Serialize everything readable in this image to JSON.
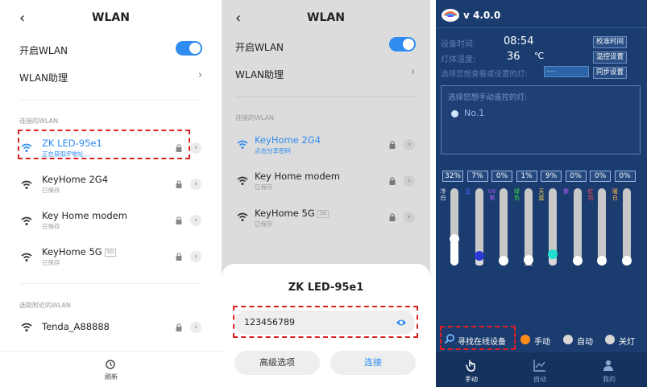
{
  "panel1": {
    "title": "WLAN",
    "wlan_toggle_label": "开启WLAN",
    "assistant_label": "WLAN助理",
    "connected_section": "连接的WLAN",
    "networks": [
      {
        "name": "ZK LED-95e1",
        "sub": "正在获取IP地址..."
      },
      {
        "name": "KeyHome 2G4",
        "sub": "已保存"
      },
      {
        "name": "Key Home modem",
        "sub": "已保存"
      },
      {
        "name": "KeyHome 5G",
        "badge": "5G",
        "sub": "已保存"
      }
    ],
    "nearby_section": "选取附近的WLAN",
    "nearby_networks": [
      {
        "name": "Tenda_A88888"
      }
    ],
    "refresh_label": "刷新"
  },
  "panel2": {
    "title": "WLAN",
    "wlan_toggle_label": "开启WLAN",
    "assistant_label": "WLAN助理",
    "connected_section": "连接的WLAN",
    "networks": [
      {
        "name": "KeyHome 2G4",
        "sub": "点击分享密码"
      },
      {
        "name": "Key Home modem",
        "sub": "已保存"
      },
      {
        "name": "KeyHome 5G",
        "badge": "5G",
        "sub": "已保存"
      }
    ],
    "dialog": {
      "title": "ZK LED-95e1",
      "password": "123456789",
      "advanced_label": "高级选项",
      "connect_label": "连接"
    }
  },
  "panel3": {
    "version": "v 4.0.0",
    "device_time_label": "设备时间:",
    "device_time": "08:54",
    "calibrate_time_label": "校准时间",
    "lamp_temp_label": "灯体温度:",
    "lamp_temp_value": "36",
    "lamp_temp_unit": "℃",
    "temp_control_label": "温控设置",
    "select_lamp_label": "选择您想查看或设置的灯:",
    "select_lamp_value": "----",
    "sync_label": "同步设置",
    "manual_prompt": "选择您想手动遥控的灯:",
    "lamp_item": "No.1",
    "channels": [
      {
        "pct": "32%",
        "label": "冷白",
        "color": "#ffffff",
        "level": 0.32,
        "thumb": "#ffffff"
      },
      {
        "pct": "7%",
        "label": "蓝",
        "color": "#3b5cff",
        "level": 0.07,
        "thumb": "#2b3bd6"
      },
      {
        "pct": "0%",
        "label": "UV紫",
        "color": "#b25cff",
        "level": 0.0,
        "thumb": "#ffffff"
      },
      {
        "pct": "1%",
        "label": "绿色",
        "color": "#3ce03c",
        "level": 0.01,
        "thumb": "#ffffff"
      },
      {
        "pct": "9%",
        "label": "天蓝",
        "color": "#ffd84a",
        "level": 0.09,
        "thumb": "#22e0d0"
      },
      {
        "pct": "0%",
        "label": "紫",
        "color": "#c35cff",
        "level": 0.0,
        "thumb": "#ffffff"
      },
      {
        "pct": "0%",
        "label": "红色",
        "color": "#ff4a4a",
        "level": 0.0,
        "thumb": "#ffffff"
      },
      {
        "pct": "0%",
        "label": "暖白",
        "color": "#ffb347",
        "level": 0.0,
        "thumb": "#ffffff"
      }
    ],
    "find_devices_label": "寻找在线设备",
    "modes": [
      {
        "label": "手动",
        "color": "#ff8c1a"
      },
      {
        "label": "自动",
        "color": "#d8d8d8"
      },
      {
        "label": "关灯",
        "color": "#d8d8d8"
      }
    ],
    "nav": [
      {
        "label": "手动",
        "color": "#ffffff"
      },
      {
        "label": "自动",
        "color": "#8ea6cc"
      },
      {
        "label": "我的",
        "color": "#8ea6cc"
      }
    ]
  }
}
